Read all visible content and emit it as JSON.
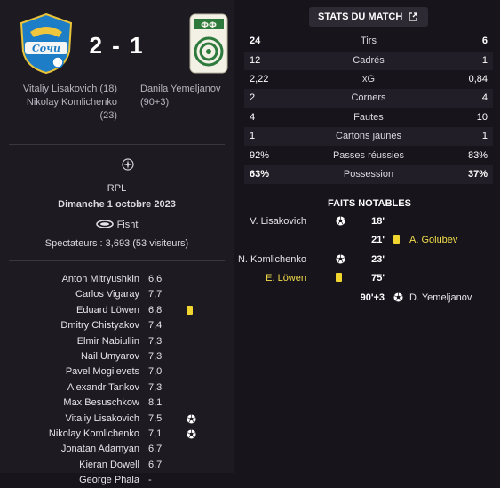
{
  "match": {
    "home_score": "2",
    "separator": "-",
    "away_score": "1",
    "home_scorers": [
      "Vitaliy Lisakovich (18)",
      "Nikolay Komlichenko",
      "(23)"
    ],
    "away_scorers": [
      "Danila Yemeljanov",
      "(90+3)"
    ],
    "competition": "RPL",
    "date": "Dimanche 1 octobre 2023",
    "stadium": "Fisht",
    "spectators": "Spectateurs : 3,693 (53 visiteurs)",
    "home_color": "#1d7dc6",
    "away_color": "#2d7a3c"
  },
  "players": [
    {
      "name": "Anton Mitryushkin",
      "rating": "6,6",
      "icon": ""
    },
    {
      "name": "Carlos Vigaray",
      "rating": "7,7",
      "icon": ""
    },
    {
      "name": "Eduard Löwen",
      "rating": "6,8",
      "icon": "yellow-card"
    },
    {
      "name": "Dmitry Chistyakov",
      "rating": "7,4",
      "icon": ""
    },
    {
      "name": "Elmir Nabiullin",
      "rating": "7,3",
      "icon": ""
    },
    {
      "name": "Nail Umyarov",
      "rating": "7,3",
      "icon": ""
    },
    {
      "name": "Pavel Mogilevets",
      "rating": "7,0",
      "icon": ""
    },
    {
      "name": "Alexandr Tankov",
      "rating": "7,3",
      "icon": ""
    },
    {
      "name": "Max Besuschkow",
      "rating": "8,1",
      "icon": ""
    },
    {
      "name": "Vitaliy Lisakovich",
      "rating": "7,5",
      "icon": "ball"
    },
    {
      "name": "Nikolay Komlichenko",
      "rating": "7,1",
      "icon": "ball"
    },
    {
      "name": "Jonatan Adamyan",
      "rating": "6,7",
      "icon": ""
    },
    {
      "name": "Kieran Dowell",
      "rating": "6,7",
      "icon": ""
    },
    {
      "name": "George Phala",
      "rating": "-",
      "icon": ""
    }
  ],
  "stats": {
    "button_label": "STATS DU MATCH",
    "rows": [
      {
        "home": "24",
        "label": "Tirs",
        "away": "6",
        "bold": true
      },
      {
        "home": "12",
        "label": "Cadrés",
        "away": "1",
        "bold": false
      },
      {
        "home": "2,22",
        "label": "xG",
        "away": "0,84",
        "bold": false
      },
      {
        "home": "2",
        "label": "Corners",
        "away": "4",
        "bold": false
      },
      {
        "home": "4",
        "label": "Fautes",
        "away": "10",
        "bold": false
      },
      {
        "home": "1",
        "label": "Cartons jaunes",
        "away": "1",
        "bold": false
      },
      {
        "home": "92%",
        "label": "Passes réussies",
        "away": "83%",
        "bold": false
      },
      {
        "home": "63%",
        "label": "Possession",
        "away": "37%",
        "bold": true
      }
    ]
  },
  "events": {
    "title": "FAITS NOTABLES",
    "items": [
      {
        "home_name": "V. Lisakovich",
        "home_icon": "ball",
        "minute": "18'",
        "away_icon": "",
        "away_name": ""
      },
      {
        "home_name": "",
        "home_icon": "",
        "minute": "21'",
        "away_icon": "yellow-card",
        "away_name": "A. Golubev"
      },
      {
        "home_name": "N. Komlichenko",
        "home_icon": "ball",
        "minute": "23'",
        "away_icon": "",
        "away_name": ""
      },
      {
        "home_name": "E. Löwen",
        "home_icon": "yellow-card",
        "minute": "75'",
        "away_icon": "",
        "away_name": ""
      },
      {
        "home_name": "",
        "home_icon": "",
        "minute": "90'+3",
        "away_icon": "ball",
        "away_name": "D. Yemeljanov"
      }
    ]
  }
}
